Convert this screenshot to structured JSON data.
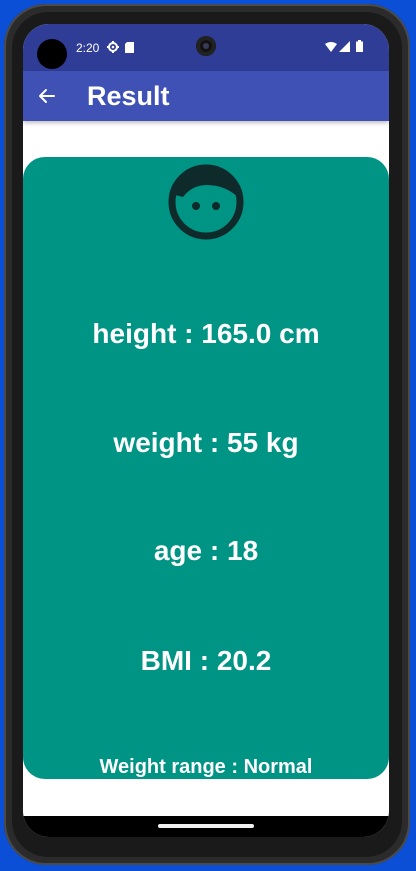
{
  "status_bar": {
    "time": "2:20",
    "icons": [
      "gear-icon",
      "sd-card-icon",
      "wifi-icon",
      "signal-icon",
      "battery-icon"
    ]
  },
  "app_bar": {
    "title": "Result",
    "back_icon": "arrow-left-icon"
  },
  "result": {
    "avatar_icon": "face-icon",
    "height_text": "height : 165.0 cm",
    "weight_text": "weight : 55 kg",
    "age_text": "age : 18",
    "bmi_text": "BMI : 20.2",
    "weight_range_text": "Weight range : Normal"
  },
  "colors": {
    "status_bar": "#2f3d96",
    "app_bar": "#3f51b5",
    "card": "#009485",
    "text": "#ffffff",
    "icon_dark": "#0f2a2a"
  }
}
